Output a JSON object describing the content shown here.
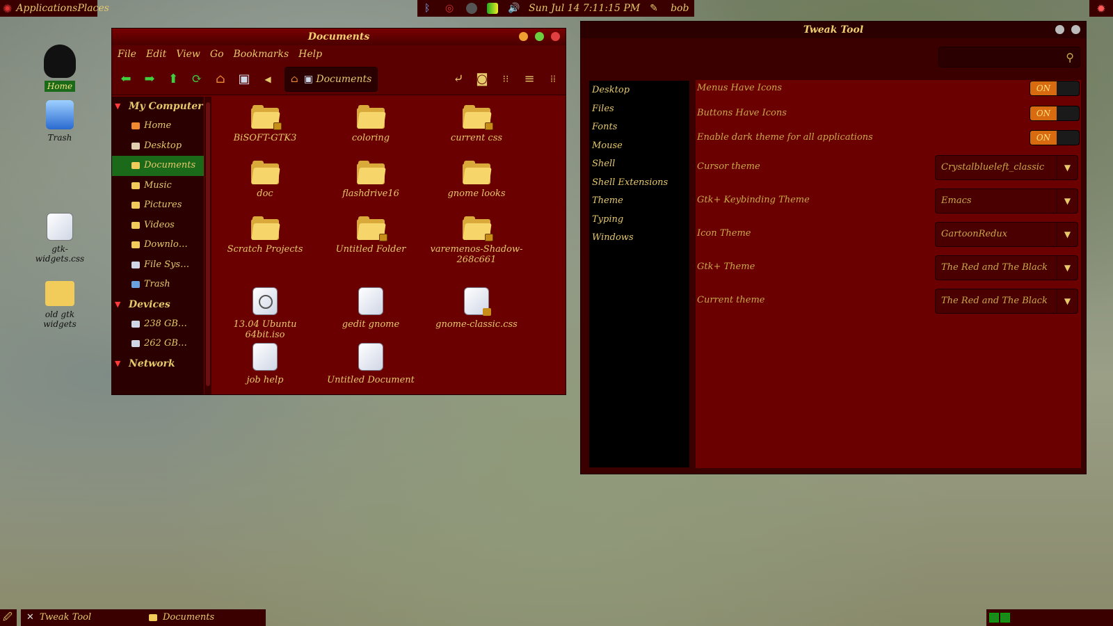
{
  "top_panel": {
    "menu_label": "ApplicationsPlaces",
    "datetime": "Sun Jul 14   7:11:15 PM",
    "user": "bob"
  },
  "desktop_icons": [
    {
      "label": "Home"
    },
    {
      "label": "Trash"
    },
    {
      "label": "gtk-widgets.css"
    },
    {
      "label": "old gtk widgets"
    }
  ],
  "file_manager": {
    "title": "Documents",
    "menu": [
      "File",
      "Edit",
      "View",
      "Go",
      "Bookmarks",
      "Help"
    ],
    "path_current": "Documents",
    "sidebar": {
      "my_computer": "My Computer",
      "items": [
        "Home",
        "Desktop",
        "Documents",
        "Music",
        "Pictures",
        "Videos",
        "Downlo…",
        "File Sys…",
        "Trash"
      ],
      "devices": "Devices",
      "device_items": [
        "238 GB…",
        "262 GB…"
      ],
      "network": "Network"
    },
    "files": [
      {
        "name": "BiSOFT-GTK3",
        "kind": "folder",
        "locked": true
      },
      {
        "name": "coloring",
        "kind": "folder",
        "locked": false
      },
      {
        "name": "current css",
        "kind": "folder",
        "locked": true
      },
      {
        "name": "doc",
        "kind": "folder",
        "locked": false
      },
      {
        "name": "flashdrive16",
        "kind": "folder",
        "locked": false
      },
      {
        "name": "gnome looks",
        "kind": "folder",
        "locked": false
      },
      {
        "name": "Scratch Projects",
        "kind": "folder",
        "locked": false
      },
      {
        "name": "Untitled Folder",
        "kind": "folder",
        "locked": true
      },
      {
        "name": "varemenos-Shadow-268c661",
        "kind": "folder",
        "locked": true
      },
      {
        "name": "13.04 Ubuntu 64bit.iso",
        "kind": "disc",
        "locked": false
      },
      {
        "name": "gedit gnome",
        "kind": "doc",
        "locked": false
      },
      {
        "name": "gnome-classic.css",
        "kind": "doc",
        "locked": true
      },
      {
        "name": "job help",
        "kind": "doc",
        "locked": false
      },
      {
        "name": "Untitled Document",
        "kind": "doc",
        "locked": false
      }
    ]
  },
  "tweak_tool": {
    "title": "Tweak Tool",
    "sections": [
      "Desktop",
      "Files",
      "Fonts",
      "Mouse",
      "Shell",
      "Shell Extensions",
      "Theme",
      "Typing",
      "Windows"
    ],
    "switches": [
      {
        "label": "Menus Have Icons",
        "state": "ON"
      },
      {
        "label": "Buttons Have Icons",
        "state": "ON"
      },
      {
        "label": "Enable dark theme for all applications",
        "state": "ON"
      }
    ],
    "combos": [
      {
        "label": "Cursor theme",
        "value": "Crystalblueleft_classic"
      },
      {
        "label": "Gtk+ Keybinding Theme",
        "value": "Emacs"
      },
      {
        "label": "Icon Theme",
        "value": "GartoonRedux"
      },
      {
        "label": "Gtk+ Theme",
        "value": "The Red and The Black"
      },
      {
        "label": "Current theme",
        "value": "The Red and The Black"
      }
    ]
  },
  "taskbar": [
    {
      "label": "Tweak Tool"
    },
    {
      "label": "Documents"
    }
  ],
  "colors": {
    "window_bg": "#6a0000",
    "accent_text": "#e6c96b",
    "selection": "#1a6a1a",
    "switch_on": "#d86a10"
  }
}
